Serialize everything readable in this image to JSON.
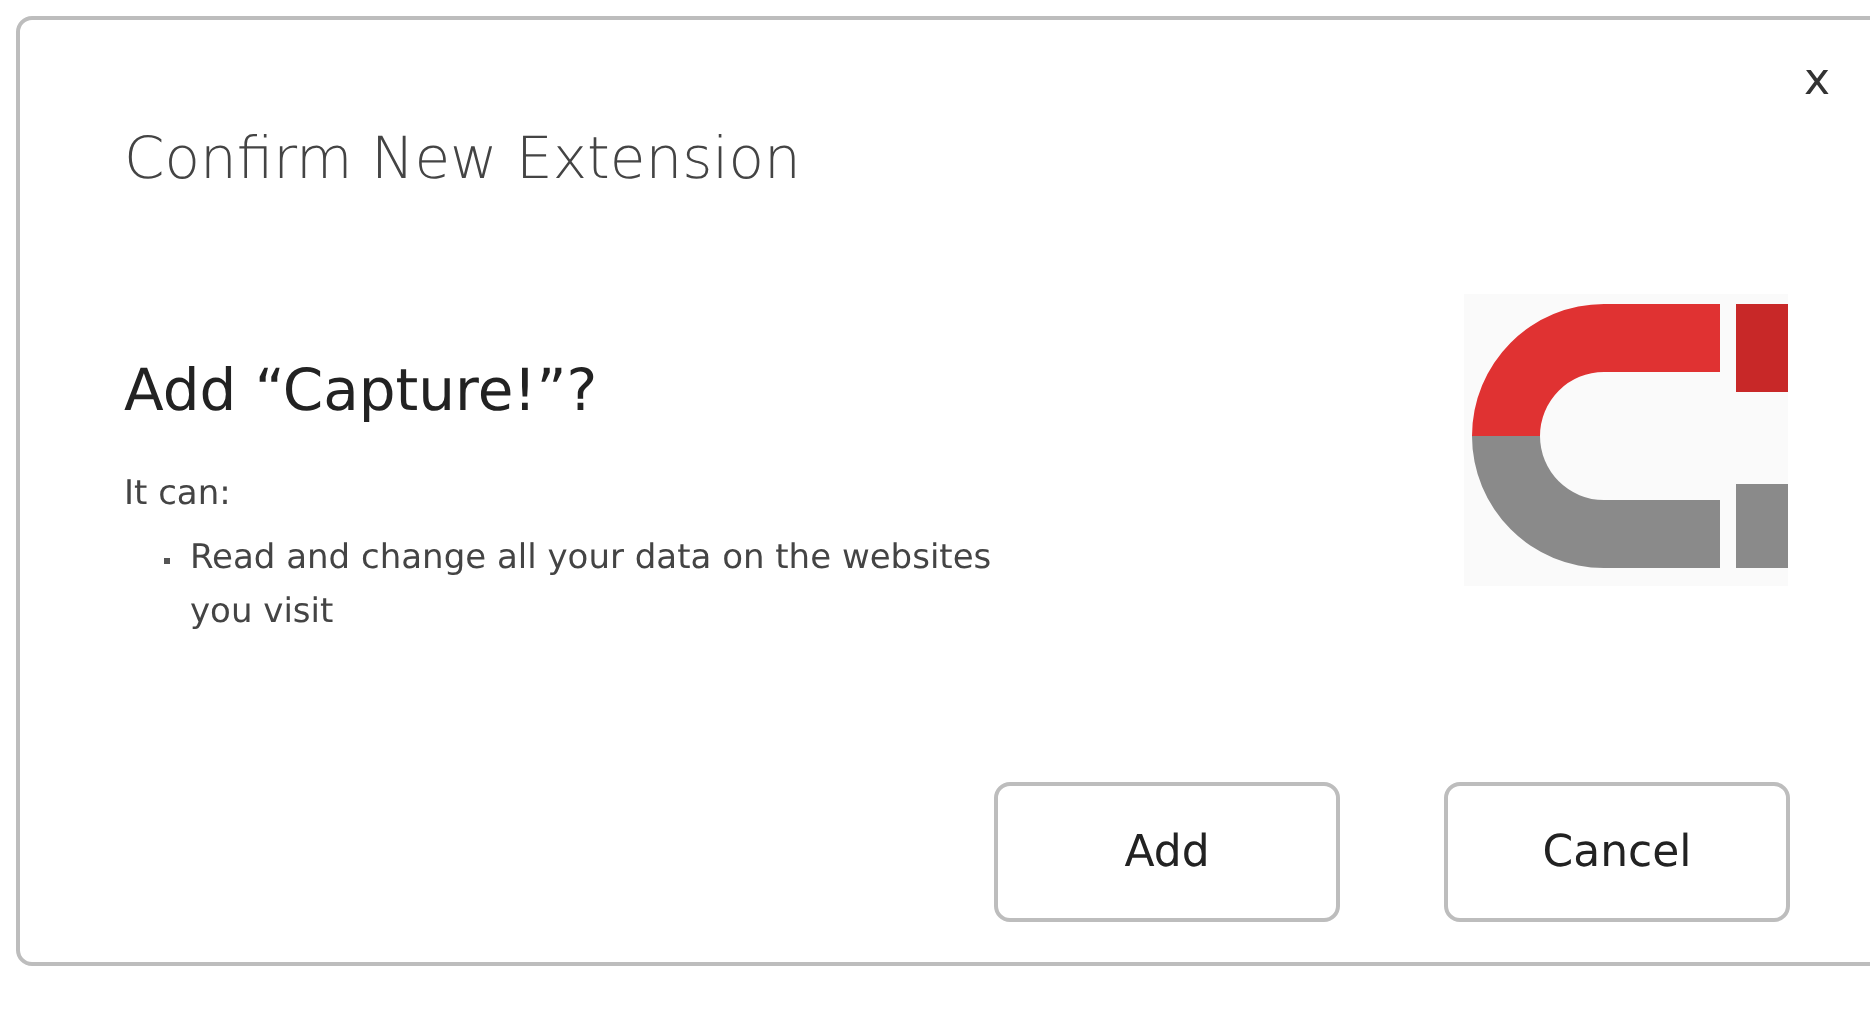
{
  "dialog": {
    "close": "x",
    "title": "Confirm New Extension",
    "heading": "Add “Capture!”?",
    "intro": "It can:",
    "permissions": [
      "Read and change all your data on the websites you visit"
    ],
    "buttons": [
      "Add",
      "Cancel"
    ]
  }
}
